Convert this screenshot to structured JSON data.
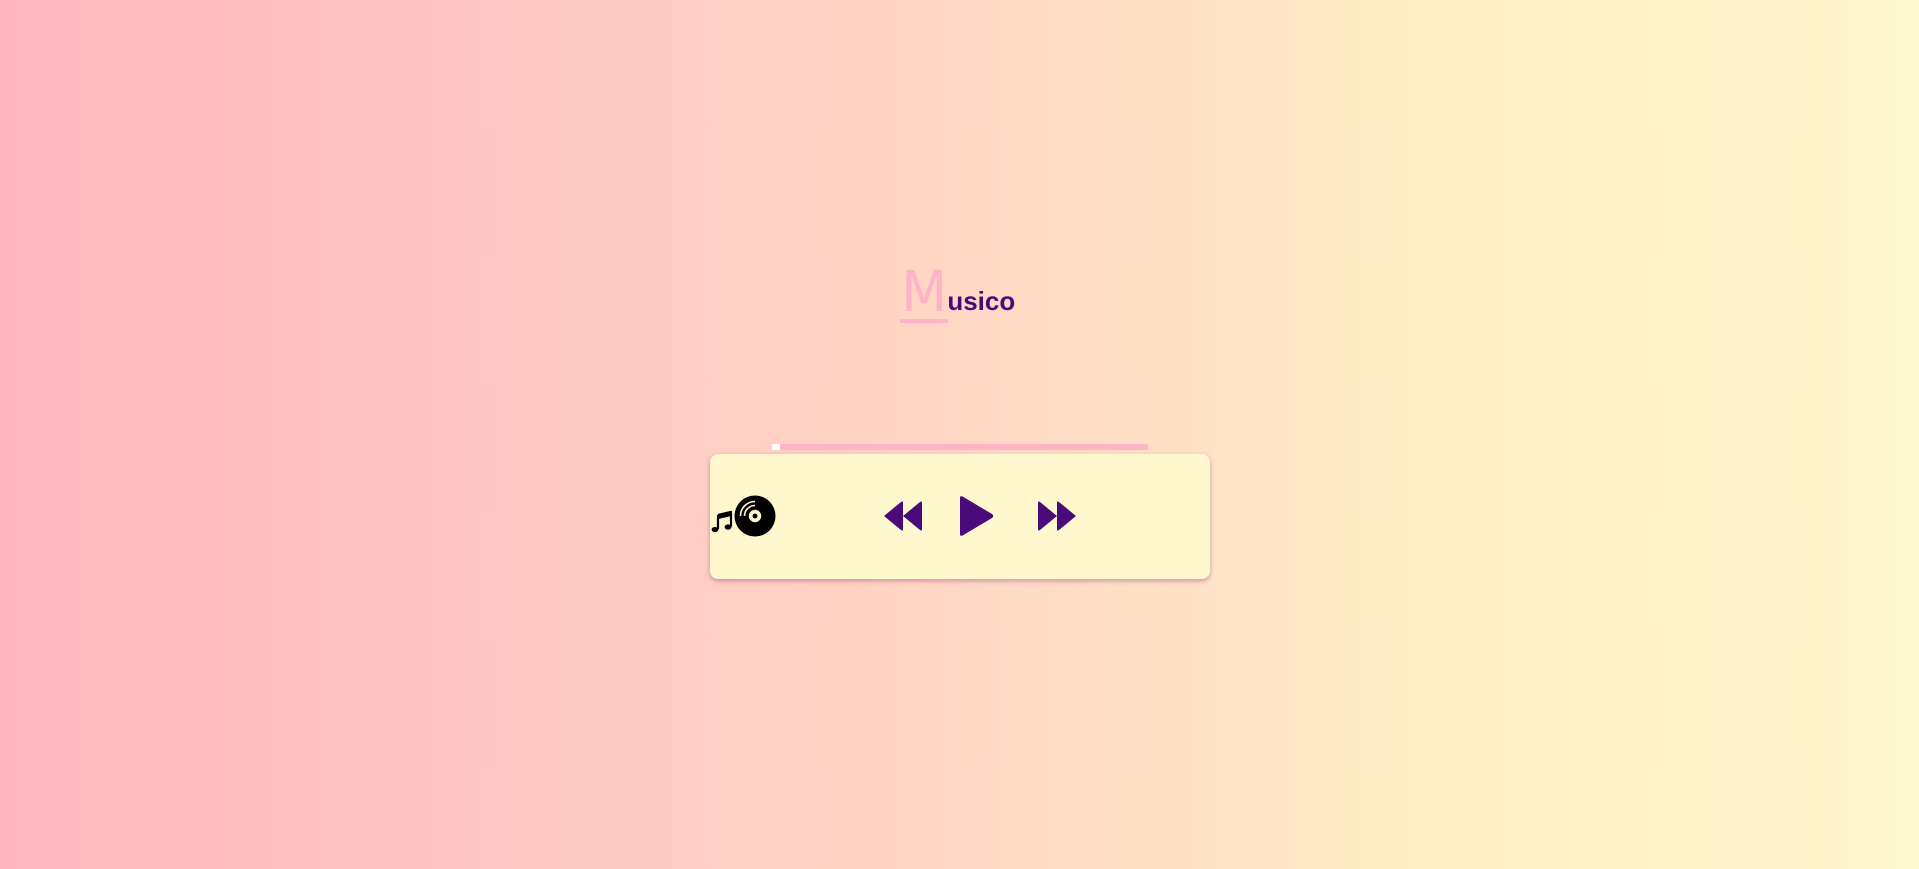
{
  "app": {
    "logo_initial": "M",
    "logo_rest": "usico"
  },
  "player": {
    "progress_fraction": 0.02,
    "controls": {
      "prev_icon": "rewind-icon",
      "play_icon": "play-icon",
      "next_icon": "fast-forward-icon"
    },
    "icons": {
      "note": "music-note-icon",
      "disc": "vinyl-disc-icon"
    }
  },
  "colors": {
    "accent_pink": "#ffb3c6",
    "brand_purple": "#4b0a7a",
    "card_background": "#fff8cf",
    "background_left": "#ffb6c1",
    "background_right": "#fff8d0"
  }
}
